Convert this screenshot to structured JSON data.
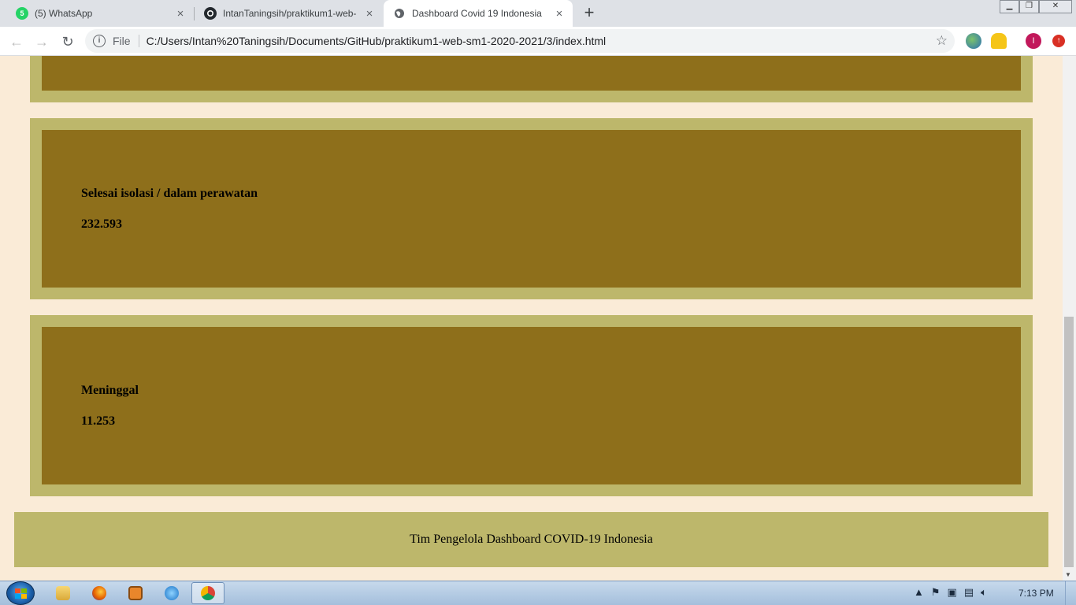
{
  "browser": {
    "tabs": [
      {
        "title": "(5) WhatsApp",
        "badge": "5",
        "active": false
      },
      {
        "title": "IntanTaningsih/praktikum1-web-",
        "active": false
      },
      {
        "title": "Dashboard Covid 19 Indonesia",
        "active": true
      }
    ],
    "new_tab_symbol": "+",
    "close_symbol": "×",
    "address": {
      "scheme_label": "File",
      "url": "C:/Users/Intan%20Taningsih/Documents/GitHub/praktikum1-web-sm1-2020-2021/3/index.html"
    },
    "profile_initial": "I"
  },
  "page": {
    "cards": [
      {
        "label": "Selesai isolasi / dalam perawatan",
        "value": "232.593"
      },
      {
        "label": "Meninggal",
        "value": "11.253"
      }
    ],
    "footer": "Tim Pengelola Dashboard COVID-19 Indonesia"
  },
  "taskbar": {
    "apps": [
      "file-explorer-icon",
      "firefox-icon",
      "media-player-icon",
      "internet-explorer-icon",
      "chrome-icon"
    ],
    "clock": "7:13 PM"
  },
  "colors": {
    "page_bg": "#faebd7",
    "card_border": "#bdb76b",
    "card_fill": "#8e6f1b",
    "footer_bg": "#bdb76b"
  }
}
